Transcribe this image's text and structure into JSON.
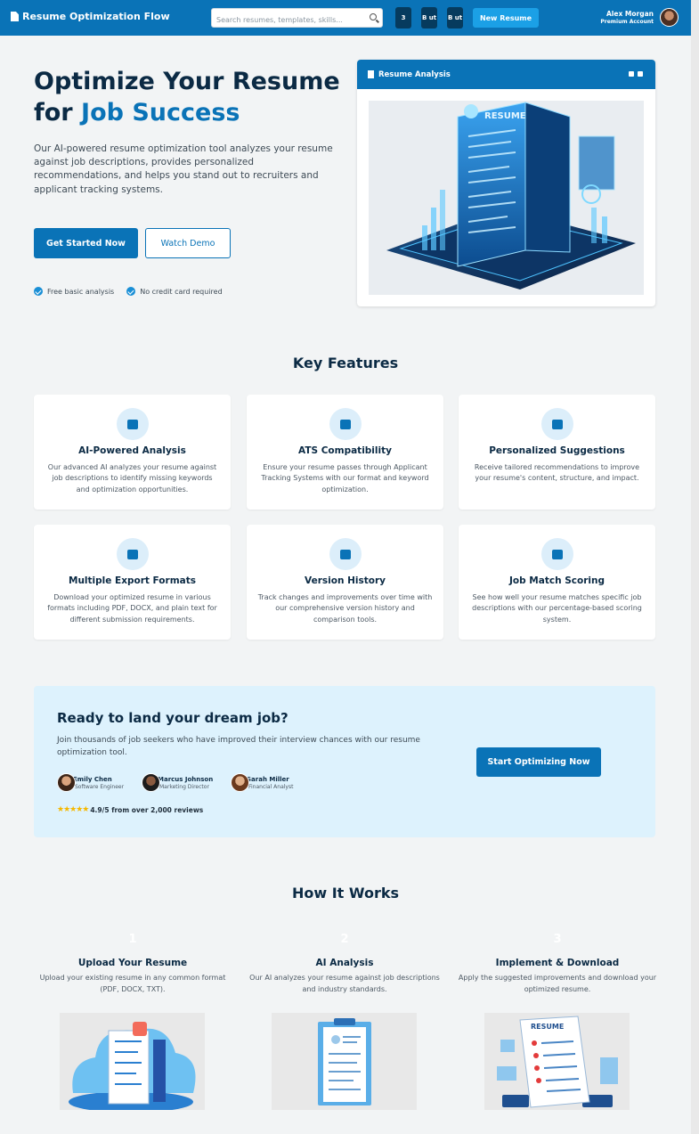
{
  "header": {
    "brand": "Resume Optimization Flow",
    "search_placeholder": "Search resumes, templates, skills...",
    "badges": [
      "3",
      "B ut",
      "B ut"
    ],
    "new_resume": "New Resume",
    "user_name": "Alex Morgan",
    "user_role": "Premium Account"
  },
  "hero": {
    "title_line1": "Optimize Your Resume",
    "title_for": "for",
    "title_accent": "Job Success",
    "description": "Our AI-powered resume optimization tool analyzes your resume against job descriptions, provides personalized recommendations, and helps you stand out to recruiters and applicant tracking systems.",
    "cta_primary": "Get Started Now",
    "cta_secondary": "Watch Demo",
    "checks": [
      "Free basic analysis",
      "No credit card required"
    ]
  },
  "analysis_card": {
    "title": "Resume Analysis",
    "illustration_label": "RESUME"
  },
  "features": {
    "title": "Key Features",
    "items": [
      {
        "icon": "robot-icon",
        "title": "AI-Powered Analysis",
        "desc": "Our advanced AI analyzes your resume against job descriptions to identify missing keywords and optimization opportunities."
      },
      {
        "icon": "chart-line-icon",
        "title": "ATS Compatibility",
        "desc": "Ensure your resume passes through Applicant Tracking Systems with our format and keyword optimization."
      },
      {
        "icon": "edit-icon",
        "title": "Personalized Suggestions",
        "desc": "Receive tailored recommendations to improve your resume's content, structure, and impact."
      },
      {
        "icon": "file-export-icon",
        "title": "Multiple Export Formats",
        "desc": "Download your optimized resume in various formats including PDF, DOCX, and plain text for different submission requirements."
      },
      {
        "icon": "history-icon",
        "title": "Version History",
        "desc": "Track changes and improvements over time with our comprehensive version history and comparison tools."
      },
      {
        "icon": "briefcase-icon",
        "title": "Job Match Scoring",
        "desc": "See how well your resume matches specific job descriptions with our percentage-based scoring system."
      }
    ]
  },
  "cta": {
    "title": "Ready to land your dream job?",
    "text": "Join thousands of job seekers who have improved their interview chances with our resume optimization tool.",
    "button": "Start Optimizing Now",
    "testimonials": [
      {
        "name": "Emily Chen",
        "role": "Software Engineer"
      },
      {
        "name": "Marcus Johnson",
        "role": "Marketing Director"
      },
      {
        "name": "Sarah Miller",
        "role": "Financial Analyst"
      }
    ],
    "stars": "★★★★★",
    "rating": 4.5,
    "rating_text": "4.9/5 from over 2,000 reviews"
  },
  "how": {
    "title": "How It Works",
    "steps": [
      {
        "num": "1",
        "title": "Upload Your Resume",
        "desc": "Upload your existing resume in any common format (PDF, DOCX, TXT)."
      },
      {
        "num": "2",
        "title": "AI Analysis",
        "desc": "Our AI analyzes your resume against job descriptions and industry standards."
      },
      {
        "num": "3",
        "title": "Implement & Download",
        "desc": "Apply the suggested improvements and download your optimized resume."
      }
    ],
    "image_label": "RESUME"
  },
  "colors": {
    "primary": "#0a73b7",
    "accent": "#1ba0e6",
    "cta_bg": "#ddf2fd"
  }
}
